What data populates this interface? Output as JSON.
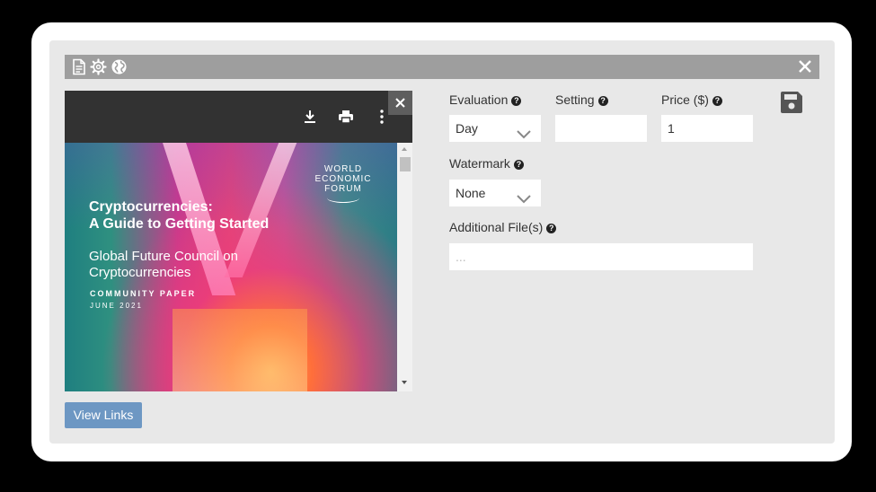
{
  "toolbar": {
    "icons": [
      "document-icon",
      "gear-icon",
      "globe-icon"
    ],
    "close_glyph": "×"
  },
  "viewer": {
    "close_glyph": "×",
    "icons": [
      "download-icon",
      "print-icon",
      "more-vert-icon"
    ],
    "page": {
      "org_line1": "WORLD",
      "org_line2": "ECONOMIC",
      "org_line3": "FORUM",
      "title_line1": "Cryptocurrencies:",
      "title_line2": "A Guide to Getting Started",
      "council_line1": "Global Future Council on",
      "council_line2": "Cryptocurrencies",
      "paper_type": "COMMUNITY PAPER",
      "date": "JUNE 2021"
    }
  },
  "form": {
    "evaluation": {
      "label": "Evaluation",
      "value": "Day"
    },
    "setting": {
      "label": "Setting",
      "value": ""
    },
    "price": {
      "label": "Price ($)",
      "value": "1"
    },
    "watermark": {
      "label": "Watermark",
      "value": "None"
    },
    "additional_files": {
      "label": "Additional File(s)",
      "placeholder": "..."
    },
    "help_glyph": "?"
  },
  "buttons": {
    "view_links": "View Links"
  },
  "colors": {
    "toolbar": "#9e9e9e",
    "viewer_bar": "#323232",
    "view_links_button": "#6d97c3",
    "panel": "#e8e8e8"
  }
}
